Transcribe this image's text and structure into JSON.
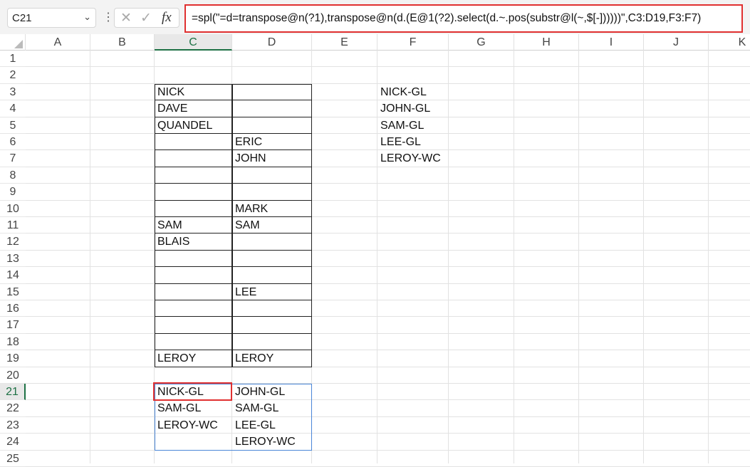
{
  "name_box": "C21",
  "formula": "=spl(\"=d=transpose@n(?1),transpose@n(d.(E@1(?2).select(d.~.pos(substr@l(~,$[-])))))\",C3:D19,F3:F7)",
  "columns": [
    "A",
    "B",
    "C",
    "D",
    "E",
    "F",
    "G",
    "H",
    "I",
    "J",
    "K"
  ],
  "rows": [
    "1",
    "2",
    "3",
    "4",
    "5",
    "6",
    "7",
    "8",
    "9",
    "10",
    "11",
    "12",
    "13",
    "14",
    "15",
    "16",
    "17",
    "18",
    "19",
    "20",
    "21",
    "22",
    "23",
    "24",
    "25"
  ],
  "selected_cell": "C21",
  "cells": {
    "C3": "NICK",
    "C4": "DAVE",
    "C5": "QUANDEL",
    "D6": "ERIC",
    "D7": "JOHN",
    "D10": "MARK",
    "C11": "SAM",
    "D11": "SAM",
    "C12": "BLAIS",
    "D15": "LEE",
    "C19": "LEROY",
    "D19": "LEROY",
    "F3": "NICK-GL",
    "F4": "JOHN-GL",
    "F5": "SAM-GL",
    "F6": "LEE-GL",
    "F7": "LEROY-WC",
    "C21": "NICK-GL",
    "D21": "JOHN-GL",
    "C22": "SAM-GL",
    "D22": "SAM-GL",
    "C23": "LEROY-WC",
    "D23": "LEE-GL",
    "D24": "LEROY-WC"
  }
}
